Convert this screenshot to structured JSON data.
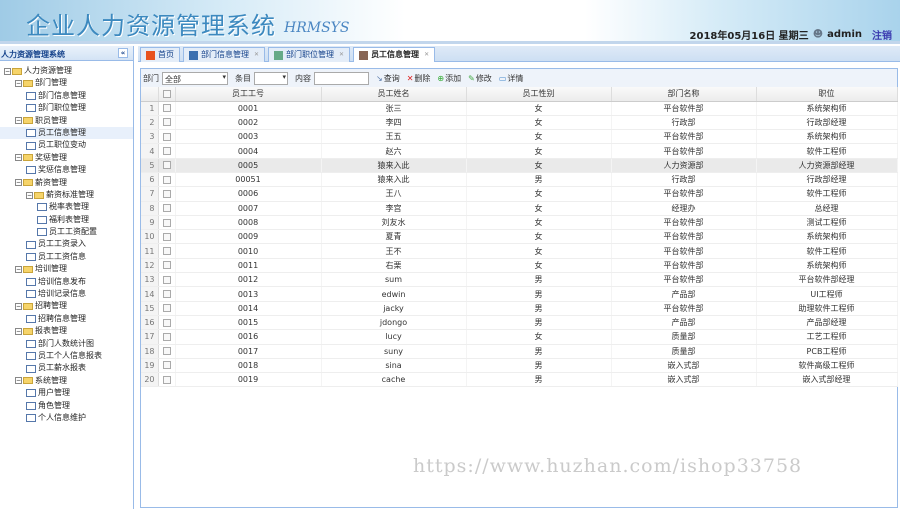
{
  "header": {
    "title": "企业人力资源管理系统",
    "subtitle": "HRMSYS",
    "date": "2018年05月16日 星期三",
    "user": "admin",
    "logout": "注销"
  },
  "sidebar": {
    "title": "人力资源管理系统",
    "collapse": "«",
    "items": [
      {
        "label": "人力资源管理",
        "level": 0,
        "type": "folder"
      },
      {
        "label": "部门管理",
        "level": 1,
        "type": "folder"
      },
      {
        "label": "部门信息管理",
        "level": 2,
        "type": "file"
      },
      {
        "label": "部门职位管理",
        "level": 2,
        "type": "file"
      },
      {
        "label": "职员管理",
        "level": 1,
        "type": "folder"
      },
      {
        "label": "员工信息管理",
        "level": 2,
        "type": "file",
        "selected": true
      },
      {
        "label": "员工职位变动",
        "level": 2,
        "type": "file"
      },
      {
        "label": "奖惩管理",
        "level": 1,
        "type": "folder"
      },
      {
        "label": "奖惩信息管理",
        "level": 2,
        "type": "file"
      },
      {
        "label": "薪资管理",
        "level": 1,
        "type": "folder"
      },
      {
        "label": "薪资标准管理",
        "level": 2,
        "type": "folder"
      },
      {
        "label": "税率表管理",
        "level": 3,
        "type": "file"
      },
      {
        "label": "福利表管理",
        "level": 3,
        "type": "file"
      },
      {
        "label": "员工工资配置",
        "level": 3,
        "type": "file"
      },
      {
        "label": "员工工资录入",
        "level": 2,
        "type": "file"
      },
      {
        "label": "员工工资信息",
        "level": 2,
        "type": "file"
      },
      {
        "label": "培训管理",
        "level": 1,
        "type": "folder"
      },
      {
        "label": "培训信息发布",
        "level": 2,
        "type": "file"
      },
      {
        "label": "培训记录信息",
        "level": 2,
        "type": "file"
      },
      {
        "label": "招聘管理",
        "level": 1,
        "type": "folder"
      },
      {
        "label": "招聘信息管理",
        "level": 2,
        "type": "file"
      },
      {
        "label": "报表管理",
        "level": 1,
        "type": "folder"
      },
      {
        "label": "部门人数统计图",
        "level": 2,
        "type": "file"
      },
      {
        "label": "员工个人信息报表",
        "level": 2,
        "type": "file"
      },
      {
        "label": "员工薪水报表",
        "level": 2,
        "type": "file"
      },
      {
        "label": "系统管理",
        "level": 1,
        "type": "folder"
      },
      {
        "label": "用户管理",
        "level": 2,
        "type": "file"
      },
      {
        "label": "角色管理",
        "level": 2,
        "type": "file"
      },
      {
        "label": "个人信息维护",
        "level": 2,
        "type": "file"
      }
    ]
  },
  "tabs": [
    {
      "label": "首页",
      "icon": "home-icon",
      "closable": false
    },
    {
      "label": "部门信息管理",
      "icon": "computer-icon",
      "closable": true
    },
    {
      "label": "部门职位管理",
      "icon": "grid-icon",
      "closable": true
    },
    {
      "label": "员工信息管理",
      "icon": "user-icon",
      "closable": true,
      "active": true
    }
  ],
  "toolbar": {
    "dept_label": "部门",
    "dept_value": "全部",
    "field_label": "条目",
    "field_value": "",
    "content_label": "内容",
    "content_value": "",
    "search": "查询",
    "delete": "删除",
    "add": "添加",
    "edit": "修改",
    "detail": "详情"
  },
  "table": {
    "columns": [
      "员工工号",
      "员工姓名",
      "员工性别",
      "部门名称",
      "职位"
    ],
    "rows": [
      [
        "0001",
        "张三",
        "女",
        "平台软件部",
        "系统架构师"
      ],
      [
        "0002",
        "李四",
        "女",
        "行政部",
        "行政部经理"
      ],
      [
        "0003",
        "王五",
        "女",
        "平台软件部",
        "系统架构师"
      ],
      [
        "0004",
        "赵六",
        "女",
        "平台软件部",
        "软件工程师"
      ],
      [
        "0005",
        "猿来入此",
        "女",
        "人力资源部",
        "人力资源部经理"
      ],
      [
        "00051",
        "猿来入此",
        "男",
        "行政部",
        "行政部经理"
      ],
      [
        "0006",
        "王八",
        "女",
        "平台软件部",
        "软件工程师"
      ],
      [
        "0007",
        "李宫",
        "女",
        "经理办",
        "总经理"
      ],
      [
        "0008",
        "刘友水",
        "女",
        "平台软件部",
        "测试工程师"
      ],
      [
        "0009",
        "夏青",
        "女",
        "平台软件部",
        "系统架构师"
      ],
      [
        "0010",
        "王不",
        "女",
        "平台软件部",
        "软件工程师"
      ],
      [
        "0011",
        "右栗",
        "女",
        "平台软件部",
        "系统架构师"
      ],
      [
        "0012",
        "sum",
        "男",
        "平台软件部",
        "平台软件部经理"
      ],
      [
        "0013",
        "edwin",
        "男",
        "产品部",
        "UI工程师"
      ],
      [
        "0014",
        "jacky",
        "男",
        "平台软件部",
        "助理软件工程师"
      ],
      [
        "0015",
        "jdongo",
        "男",
        "产品部",
        "产品部经理"
      ],
      [
        "0016",
        "lucy",
        "女",
        "质量部",
        "工艺工程师"
      ],
      [
        "0017",
        "suny",
        "男",
        "质量部",
        "PCB工程师"
      ],
      [
        "0018",
        "sina",
        "男",
        "嵌入式部",
        "软件高级工程师"
      ],
      [
        "0019",
        "cache",
        "男",
        "嵌入式部",
        "嵌入式部经理"
      ]
    ]
  },
  "watermark": "https://www.huzhan.com/ishop33758"
}
